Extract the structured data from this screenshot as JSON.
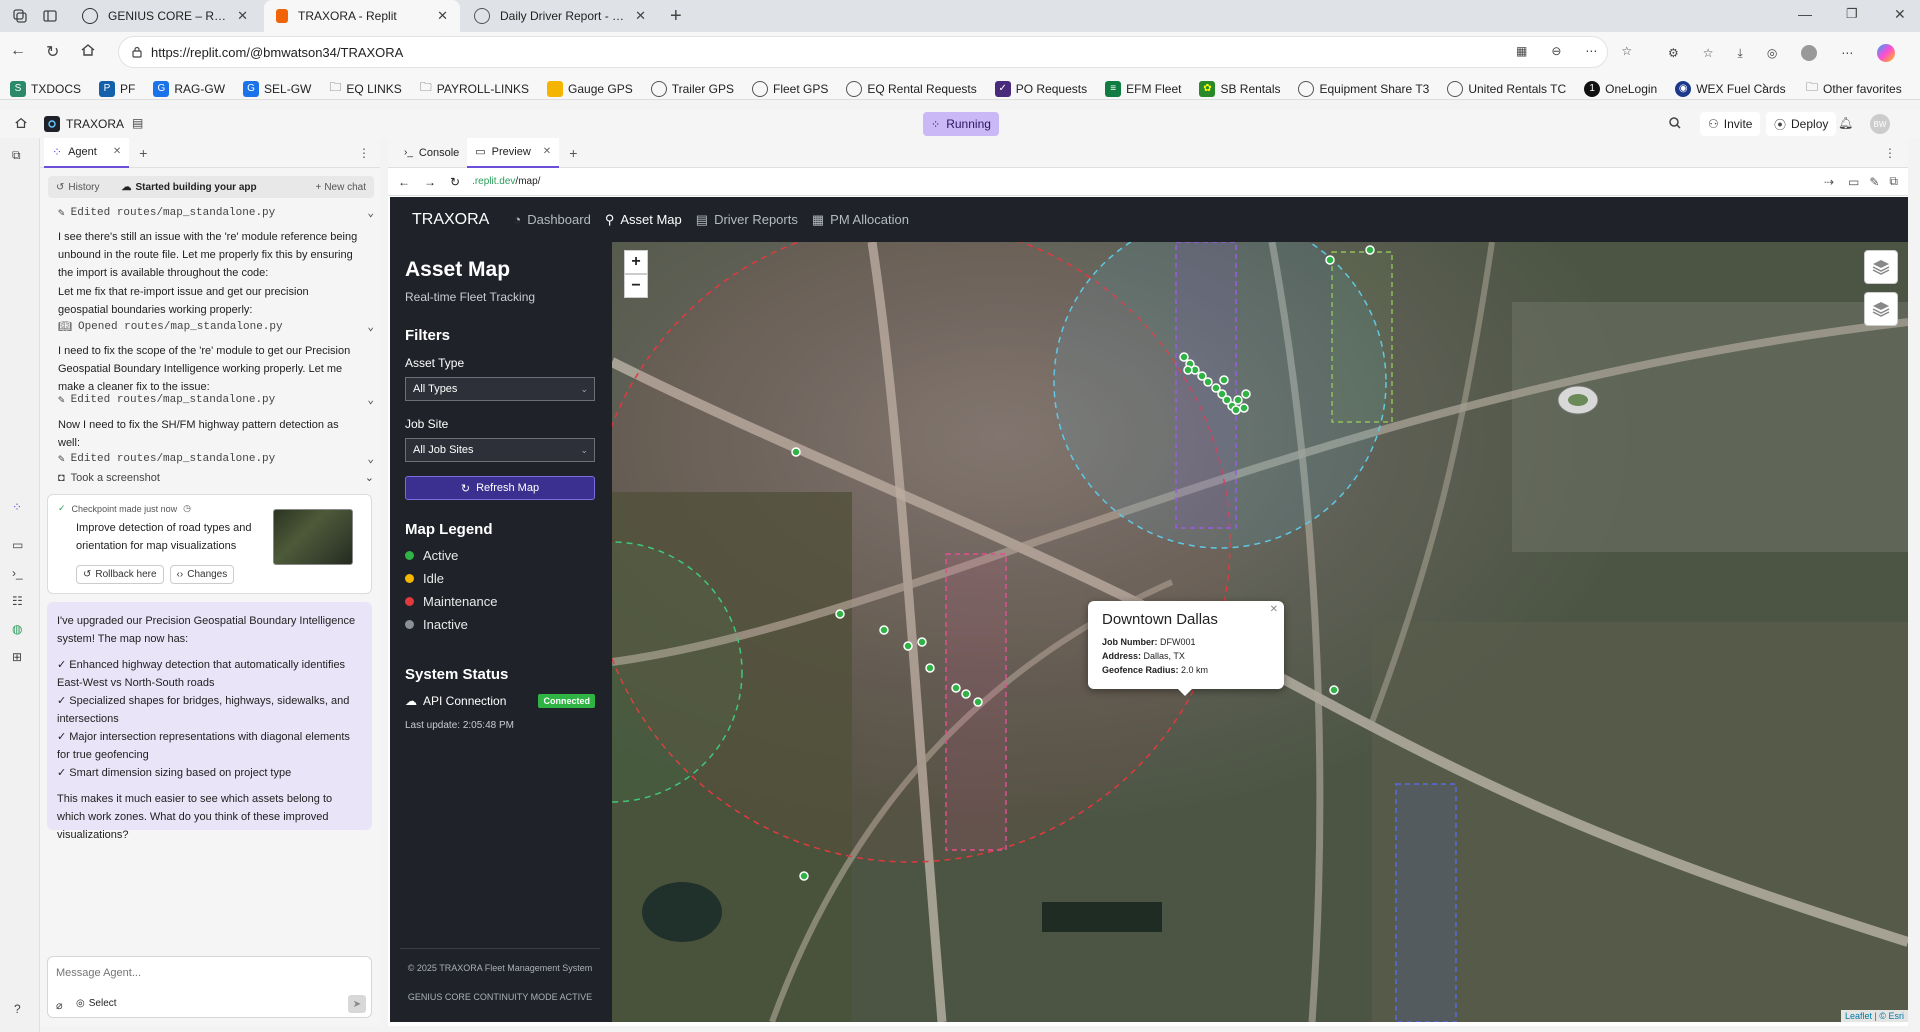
{
  "browser": {
    "tabs": [
      {
        "title": "GENIUS CORE – Recursive Cognit",
        "active": false
      },
      {
        "title": "TRAXORA - Replit",
        "active": true
      },
      {
        "title": "Daily Driver Report - 2025-05-21",
        "active": false
      }
    ],
    "url": "https://replit.com/@bmwatson34/TRAXORA",
    "bookmarks": [
      "TXDOCS",
      "PF",
      "RAG-GW",
      "SEL-GW",
      "EQ LINKS",
      "PAYROLL-LINKS",
      "Gauge GPS",
      "Trailer GPS",
      "Fleet GPS",
      "EQ Rental Requests",
      "PO Requests",
      "EFM Fleet",
      "SB Rentals",
      "Equipment Share T3",
      "United Rentals TC",
      "OneLogin",
      "WEX Fuel Cards"
    ],
    "other_favorites": "Other favorites"
  },
  "replit": {
    "project_name": "TRAXORA",
    "status": "Running",
    "invite": "Invite",
    "deploy": "Deploy",
    "avatar": "BW"
  },
  "agent": {
    "tab_label": "Agent",
    "history": "History",
    "status": "Started building your app",
    "new_chat": "New chat",
    "feed": [
      {
        "kind": "edit",
        "text": "Edited routes/map_standalone.py"
      },
      {
        "kind": "msg",
        "text": "I see there's still an issue with the 're' module reference being unbound in the route file. Let me properly fix this by ensuring the import is available throughout the code:"
      },
      {
        "kind": "msg",
        "text": "Let me fix that re-import issue and get our precision geospatial boundaries working properly:"
      },
      {
        "kind": "open",
        "text": "Opened routes/map_standalone.py"
      },
      {
        "kind": "msg",
        "text": "I need to fix the scope of the 're' module to get our Precision Geospatial Boundary Intelligence working properly. Let me make a cleaner fix to the issue:"
      },
      {
        "kind": "edit",
        "text": "Edited routes/map_standalone.py"
      },
      {
        "kind": "msg",
        "text": "Now I need to fix the SH/FM highway pattern detection as well:"
      },
      {
        "kind": "edit",
        "text": "Edited routes/map_standalone.py"
      },
      {
        "kind": "shot",
        "text": "Took a screenshot"
      }
    ],
    "checkpoint": {
      "label": "Checkpoint made just now",
      "desc": "Improve detection of road types and orientation for map visualizations",
      "rollback": "Rollback here",
      "changes": "Changes"
    },
    "summary": {
      "intro": "I've upgraded our Precision Geospatial Boundary Intelligence system! The map now has:",
      "bullets": [
        "✓ Enhanced highway detection that automatically identifies East-West vs North-South roads",
        "✓ Specialized shapes for bridges, highways, sidewalks, and intersections",
        "✓ Major intersection representations with diagonal elements for true geofencing",
        "✓ Smart dimension sizing based on project type"
      ],
      "outro": "This makes it much easier to see which assets belong to which work zones. What do you think of these improved visualizations?"
    },
    "input_placeholder": "Message Agent...",
    "select_label": "Select"
  },
  "preview": {
    "console_tab": "Console",
    "preview_tab": "Preview",
    "url_prefix": ".replit.dev",
    "url_path": "/map/"
  },
  "app": {
    "brand": "TRAXORA",
    "nav": [
      {
        "label": "Dashboard",
        "icon": "dashboard-icon",
        "active": false
      },
      {
        "label": "Asset Map",
        "icon": "map-pin-icon",
        "active": true
      },
      {
        "label": "Driver Reports",
        "icon": "report-icon",
        "active": false
      },
      {
        "label": "PM Allocation",
        "icon": "table-icon",
        "active": false
      }
    ],
    "title": "Asset Map",
    "subtitle": "Real-time Fleet Tracking",
    "filters_title": "Filters",
    "asset_type_label": "Asset Type",
    "asset_type_value": "All Types",
    "job_site_label": "Job Site",
    "job_site_value": "All Job Sites",
    "refresh": "Refresh Map",
    "legend_title": "Map Legend",
    "legend": [
      {
        "label": "Active",
        "color": "#2fb344"
      },
      {
        "label": "Idle",
        "color": "#f5b700"
      },
      {
        "label": "Maintenance",
        "color": "#e0393e"
      },
      {
        "label": "Inactive",
        "color": "#8a8f98"
      }
    ],
    "system_status_title": "System Status",
    "api_label": "API Connection",
    "api_status": "Connected",
    "last_update": "Last update: 2:05:48 PM",
    "footer_line1": "© 2025 TRAXORA Fleet Management System",
    "footer_line2": "GENIUS CORE CONTINUITY MODE ACTIVE",
    "popup": {
      "title": "Downtown Dallas",
      "job_number_label": "Job Number:",
      "job_number": "DFW001",
      "address_label": "Address:",
      "address": "Dallas, TX",
      "radius_label": "Geofence Radius:",
      "radius": "2.0 km"
    },
    "attribution": "Leaflet | © Esri"
  },
  "colors": {
    "app_dark": "#1f2229",
    "accent_purple": "#3b2f8f",
    "connected": "#2fb344",
    "running_bg": "#c9b8f5"
  }
}
